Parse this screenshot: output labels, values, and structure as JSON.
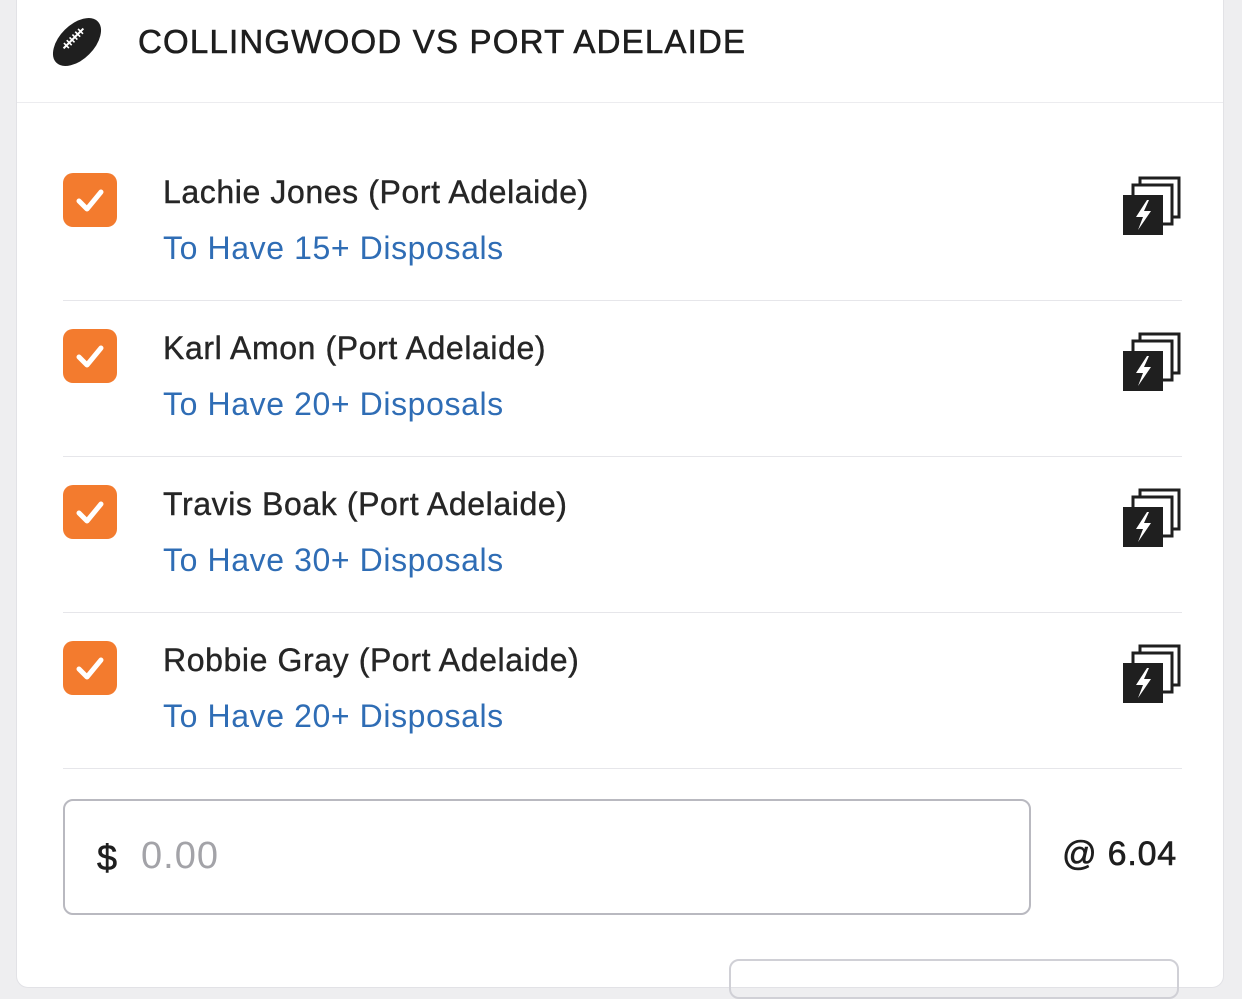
{
  "header": {
    "icon": "football-icon",
    "title": "COLLINGWOOD VS PORT ADELAIDE"
  },
  "legs": [
    {
      "checked": true,
      "player": "Lachie Jones (Port Adelaide)",
      "market": "To Have 15+ Disposals",
      "icon": "same-game-multi-icon"
    },
    {
      "checked": true,
      "player": "Karl Amon (Port Adelaide)",
      "market": "To Have 20+ Disposals",
      "icon": "same-game-multi-icon"
    },
    {
      "checked": true,
      "player": "Travis Boak (Port Adelaide)",
      "market": "To Have 30+ Disposals",
      "icon": "same-game-multi-icon"
    },
    {
      "checked": true,
      "player": "Robbie Gray (Port Adelaide)",
      "market": "To Have 20+ Disposals",
      "icon": "same-game-multi-icon"
    }
  ],
  "stake": {
    "currency_symbol": "$",
    "value": "",
    "placeholder": "0.00"
  },
  "odds": "@ 6.04",
  "colors": {
    "accent_orange": "#f37b2e",
    "market_blue": "#2f6db5",
    "text_dark": "#262626",
    "background": "#eeeef0"
  }
}
